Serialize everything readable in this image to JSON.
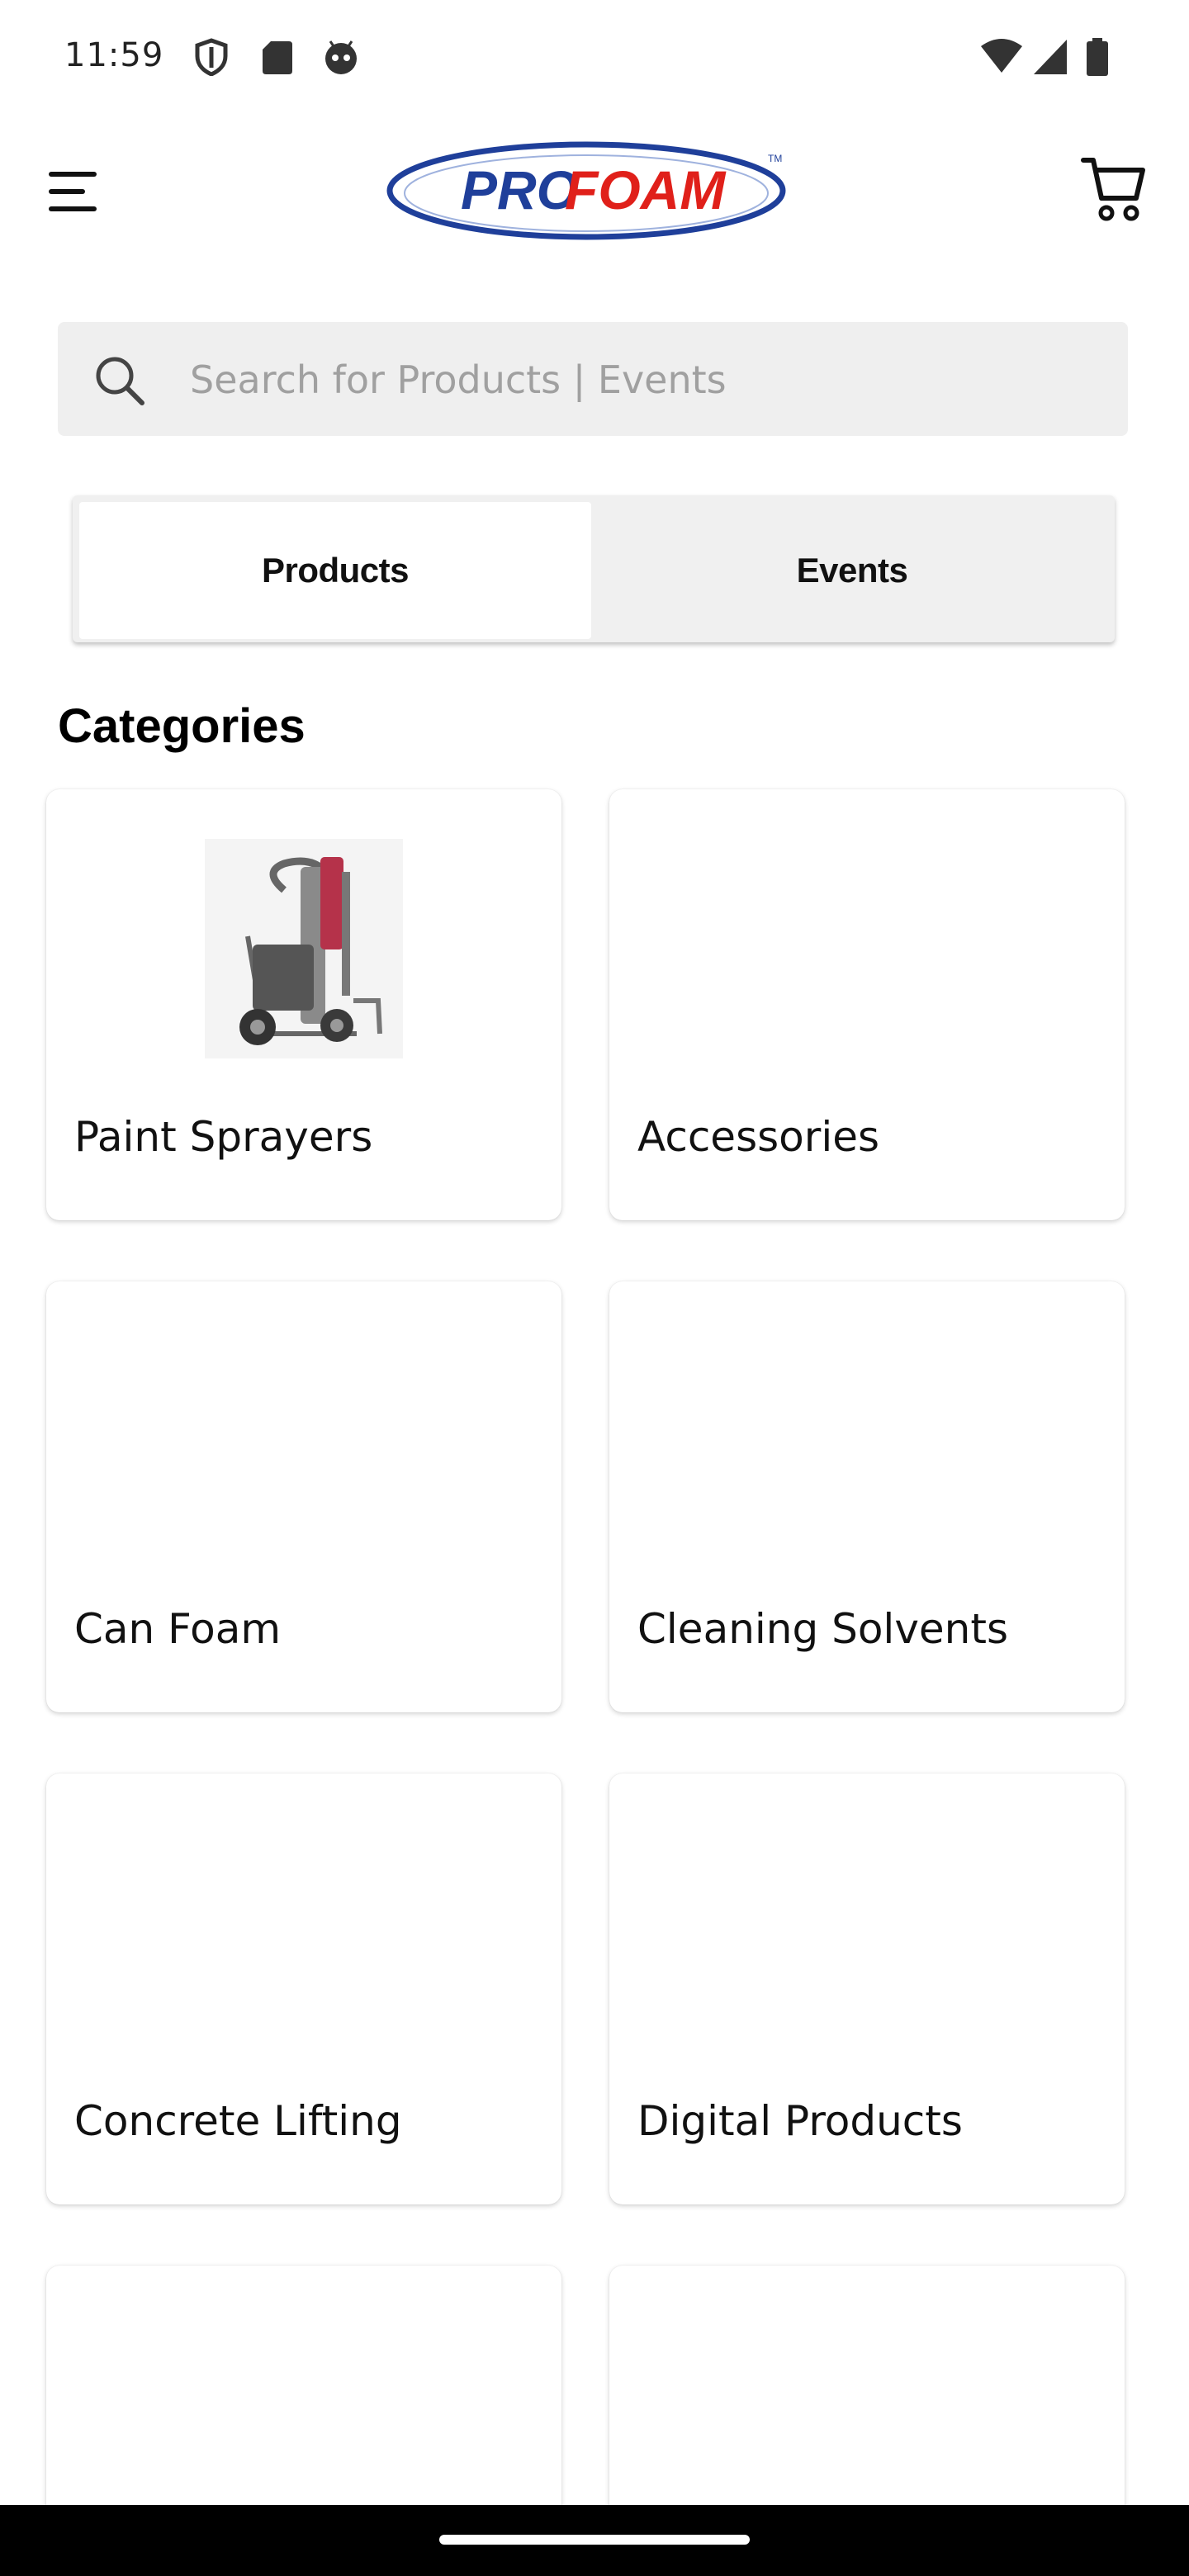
{
  "status_bar": {
    "time": "11:59",
    "left_icons": [
      "shield-icon",
      "sd-card-icon",
      "robot-icon"
    ],
    "right_icons": [
      "wifi-icon",
      "cellular-signal-icon",
      "battery-icon"
    ]
  },
  "header": {
    "logo_text": "PROFOAM",
    "menu_icon": "hamburger-menu-icon",
    "cart_icon": "shopping-cart-icon"
  },
  "search": {
    "placeholder": "Search for Products | Events"
  },
  "tabs": [
    {
      "label": "Products",
      "selected": true
    },
    {
      "label": "Events",
      "selected": false
    }
  ],
  "categories": {
    "title": "Categories",
    "items": [
      {
        "label": "Paint Sprayers",
        "image": "paint-sprayer-image"
      },
      {
        "label": "Accessories"
      },
      {
        "label": "Can Foam"
      },
      {
        "label": "Cleaning Solvents"
      },
      {
        "label": "Concrete Lifting"
      },
      {
        "label": "Digital Products"
      },
      {
        "label": ""
      },
      {
        "label": ""
      }
    ]
  },
  "colors": {
    "logo_blue": "#1f3f9a",
    "logo_red": "#e0201a",
    "search_bg": "#efefef",
    "tab_bg": "#f0f0f0"
  }
}
